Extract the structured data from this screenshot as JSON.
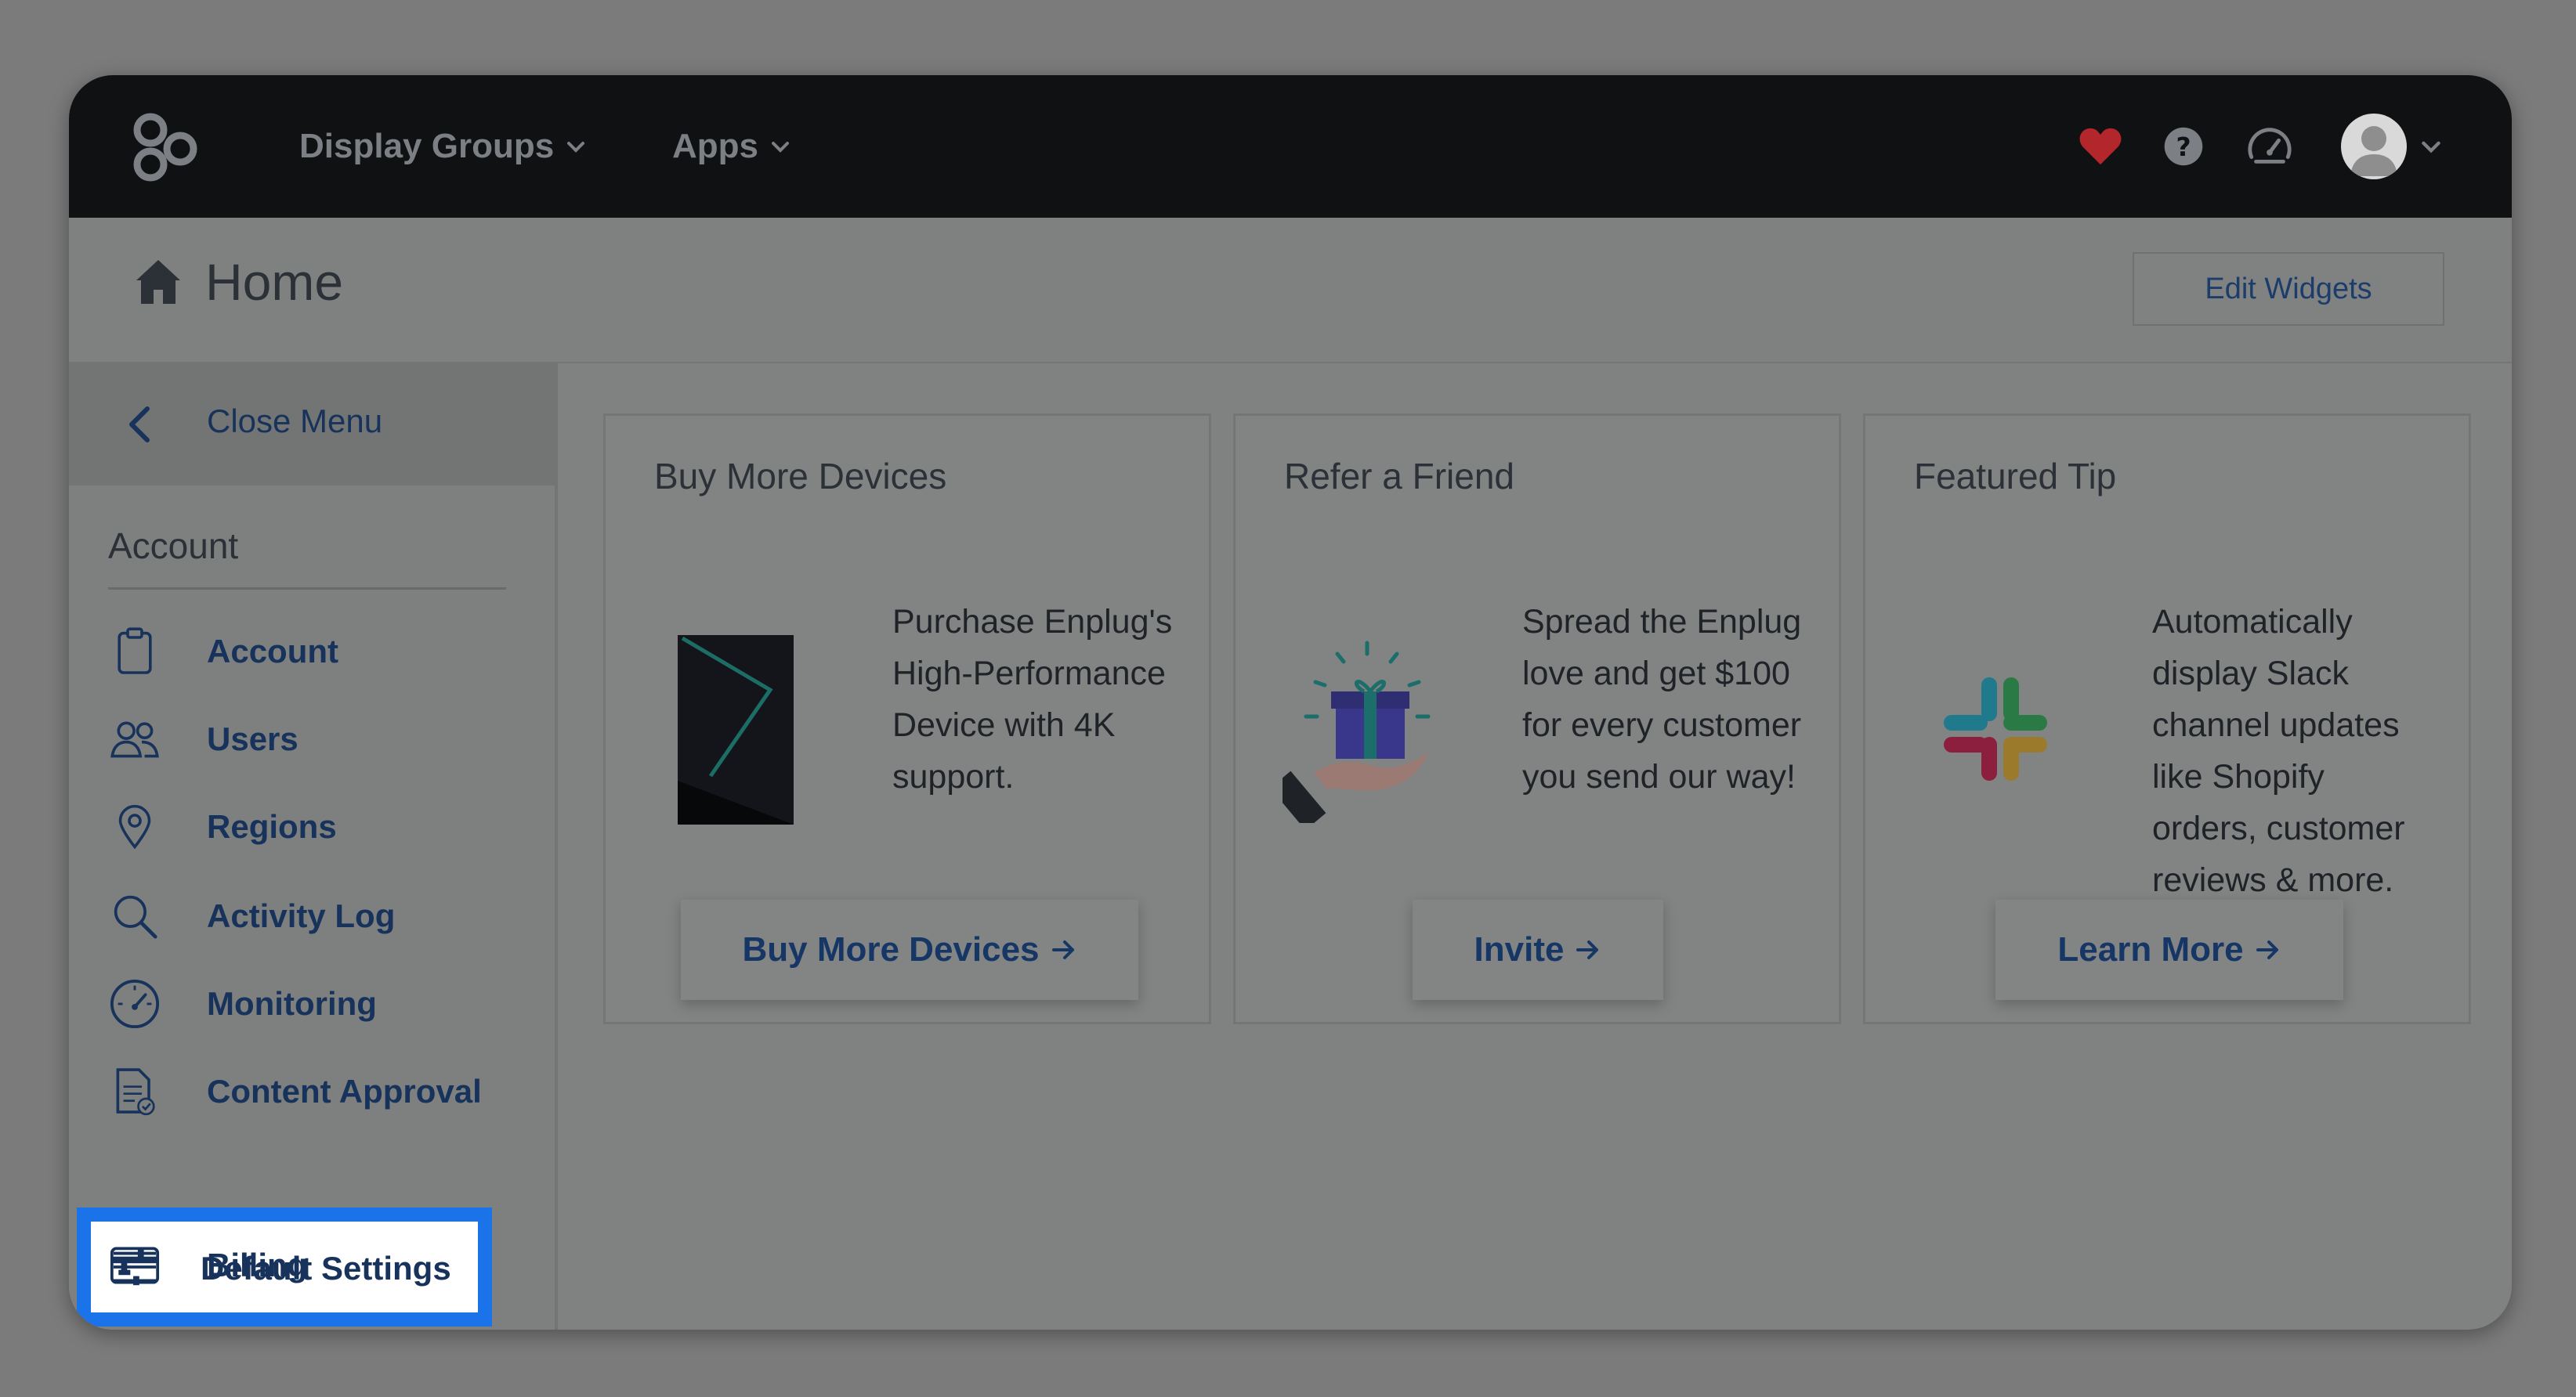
{
  "topbar": {
    "nav": [
      {
        "label": "Display Groups"
      },
      {
        "label": "Apps"
      }
    ],
    "icons": [
      "logo-icon",
      "heart-icon",
      "help-icon",
      "speedometer-icon",
      "avatar"
    ]
  },
  "header": {
    "title": "Home",
    "edit_widgets_label": "Edit Widgets"
  },
  "sidebar": {
    "close_menu_label": "Close Menu",
    "section_title": "Account",
    "items": [
      {
        "label": "Account",
        "icon": "clipboard-icon"
      },
      {
        "label": "Users",
        "icon": "users-icon"
      },
      {
        "label": "Regions",
        "icon": "map-pin-icon"
      },
      {
        "label": "Activity Log",
        "icon": "search-icon"
      },
      {
        "label": "Monitoring",
        "icon": "speedometer-icon"
      },
      {
        "label": "Content Approval",
        "icon": "document-check-icon"
      },
      {
        "label": "Default Settings",
        "icon": "sliders-icon",
        "active": true
      },
      {
        "label": "Billing",
        "icon": "credit-card-icon"
      }
    ],
    "highlight_color": "#1a73e8"
  },
  "cards": [
    {
      "title": "Buy More Devices",
      "text": "Purchase Enplug's High-Performance Device with 4K support.",
      "button": "Buy More Devices"
    },
    {
      "title": "Refer a Friend",
      "text": "Spread the Enplug love and get $100 for every customer you send our way!",
      "button": "Invite"
    },
    {
      "title": "Featured Tip",
      "text": "Automatically display Slack channel updates like Shopify orders, customer reviews & more.",
      "button": "Learn More"
    }
  ],
  "colors": {
    "topbar_bg": "#101113",
    "link_blue": "#17335b",
    "heart_red": "#b3262b"
  }
}
